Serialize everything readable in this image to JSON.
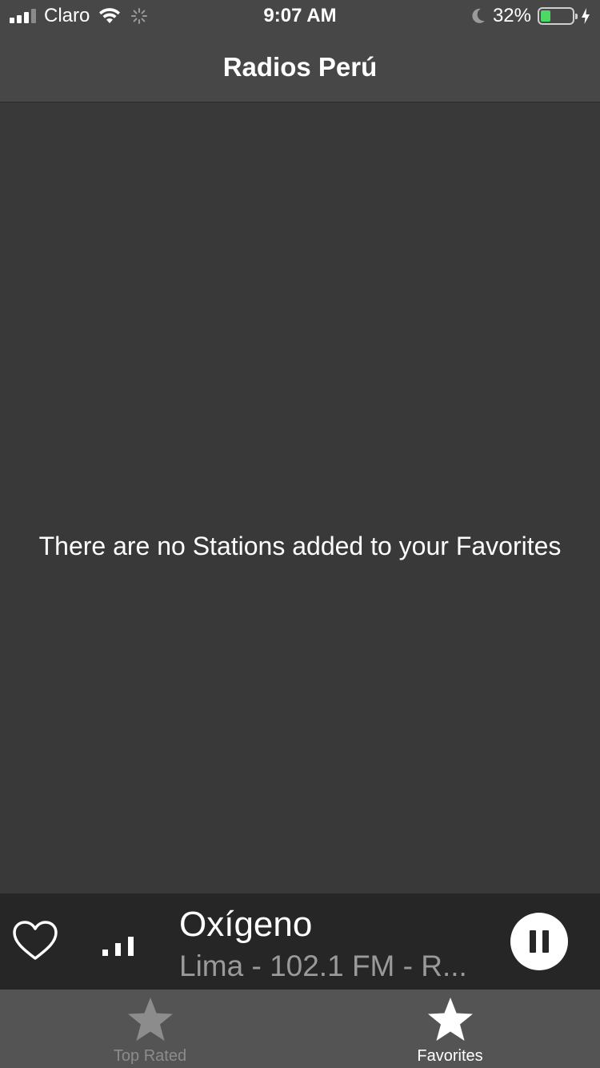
{
  "status_bar": {
    "carrier": "Claro",
    "time": "9:07 AM",
    "battery_percent": "32%",
    "battery_level": 0.32,
    "battery_color": "#4cd964"
  },
  "nav": {
    "title": "Radios Perú"
  },
  "content": {
    "empty_message": "There are no Stations added to your Favorites"
  },
  "player": {
    "station_name": "Oxígeno",
    "station_subtitle": "Lima - 102.1 FM - R...",
    "favorite_icon": "heart-outline-icon",
    "level_icon": "signal-bars-icon",
    "control_icon": "pause-icon"
  },
  "tabs": [
    {
      "label": "Top Rated",
      "icon": "star-icon",
      "active": false
    },
    {
      "label": "Favorites",
      "icon": "star-icon",
      "active": true
    }
  ],
  "colors": {
    "background": "#393939",
    "bar": "#474747",
    "player": "#262626",
    "tab_bar": "#545454",
    "inactive": "#8c8c8c"
  }
}
